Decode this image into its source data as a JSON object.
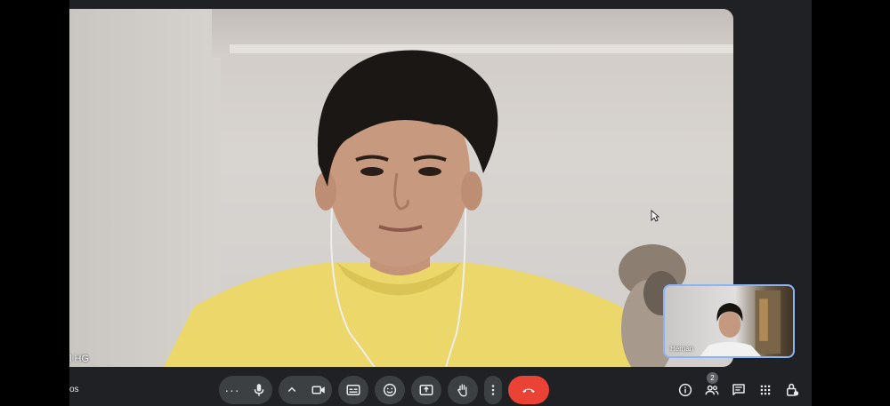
{
  "main_video": {
    "participant_name": "l HG"
  },
  "self_view": {
    "participant_name": "Hernan"
  },
  "bottom_bar": {
    "meeting_code": "os",
    "more_left_label": "···",
    "participants_count": "2",
    "end_call_color": "#ea4335"
  },
  "icons": {
    "mic": "microphone-icon",
    "camera": "camera-icon",
    "captions": "captions-icon",
    "reactions": "emoji-icon",
    "present": "present-screen-icon",
    "raise_hand": "raise-hand-icon",
    "more": "more-vert-icon",
    "end_call": "call-end-icon",
    "info": "info-icon",
    "people": "people-icon",
    "chat": "chat-icon",
    "activities": "apps-grid-icon",
    "host_controls": "lock-person-icon"
  }
}
